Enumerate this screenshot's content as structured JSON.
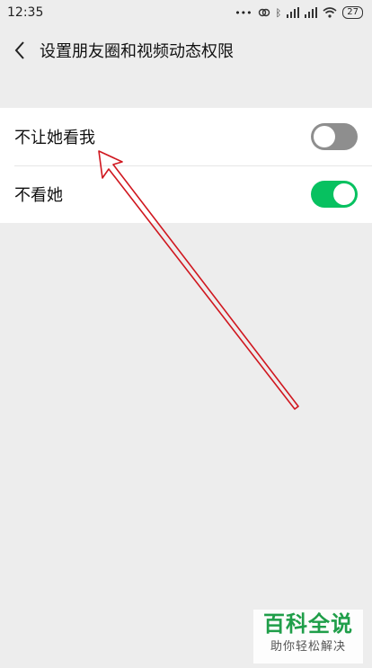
{
  "status_bar": {
    "time": "12:35",
    "icons": [
      "dots-icon",
      "loop-icon",
      "bluetooth-icon",
      "signal-icon",
      "signal-icon",
      "wifi-icon"
    ],
    "battery": "27"
  },
  "nav": {
    "title": "设置朋友圈和视频动态权限"
  },
  "settings": [
    {
      "label": "不让她看我",
      "enabled": false
    },
    {
      "label": "不看她",
      "enabled": true
    }
  ],
  "watermark": {
    "title": "百科全说",
    "subtitle": "助你轻松解决"
  },
  "colors": {
    "accent": "#07c160",
    "annotation": "#d0171f",
    "background": "#ededed"
  }
}
